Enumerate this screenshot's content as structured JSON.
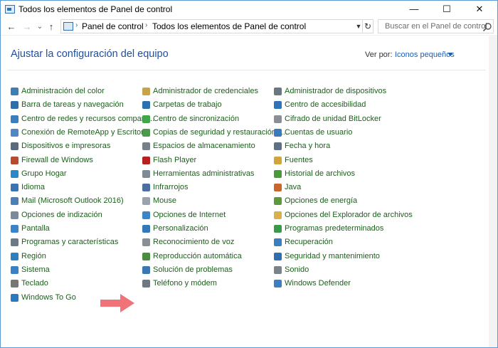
{
  "window": {
    "title": "Todos los elementos de Panel de control"
  },
  "controls": {
    "minimize": "—",
    "maximize": "☐",
    "close": "✕"
  },
  "nav": {
    "back": "←",
    "forward": "→",
    "recent": "⌄",
    "up": "↑"
  },
  "address": {
    "part1": "Panel de control",
    "part2": "Todos los elementos de Panel de control",
    "sep": "›"
  },
  "search": {
    "placeholder": "Buscar en el Panel de control"
  },
  "main": {
    "title": "Ajustar la configuración del equipo",
    "view_by_label": "Ver por:",
    "view_by_value": "Iconos pequeños"
  },
  "columns": [
    [
      {
        "label": "Administración del color",
        "icon": "color-management-icon",
        "color": "#3d7fb5"
      },
      {
        "label": "Barra de tareas y navegación",
        "icon": "taskbar-icon",
        "color": "#2f6ea8"
      },
      {
        "label": "Centro de redes y recursos comparti...",
        "icon": "network-icon",
        "color": "#3a7ebf"
      },
      {
        "label": "Conexión de RemoteApp y Escritorio",
        "icon": "remoteapp-icon",
        "color": "#4f86c6"
      },
      {
        "label": "Dispositivos e impresoras",
        "icon": "printer-icon",
        "color": "#5a6a7a"
      },
      {
        "label": "Firewall de Windows",
        "icon": "firewall-icon",
        "color": "#b84a2e"
      },
      {
        "label": "Grupo Hogar",
        "icon": "homegroup-icon",
        "color": "#2a88c8"
      },
      {
        "label": "Idioma",
        "icon": "language-icon",
        "color": "#3b73b0"
      },
      {
        "label": "Mail (Microsoft Outlook 2016)",
        "icon": "mail-icon",
        "color": "#4a7fb8"
      },
      {
        "label": "Opciones de indización",
        "icon": "indexing-icon",
        "color": "#7a8a99"
      },
      {
        "label": "Pantalla",
        "icon": "display-icon",
        "color": "#3a85c9"
      },
      {
        "label": "Programas y características",
        "icon": "programs-icon",
        "color": "#6c7a88"
      },
      {
        "label": "Región",
        "icon": "region-icon",
        "color": "#2f7fc0"
      },
      {
        "label": "Sistema",
        "icon": "system-icon",
        "color": "#3a80c4"
      },
      {
        "label": "Teclado",
        "icon": "keyboard-icon",
        "color": "#777777"
      },
      {
        "label": "Windows To Go",
        "icon": "windows-to-go-icon",
        "color": "#2b7ac0"
      }
    ],
    [
      {
        "label": "Administrador de credenciales",
        "icon": "credential-icon",
        "color": "#c8a24a"
      },
      {
        "label": "Carpetas de trabajo",
        "icon": "work-folders-icon",
        "color": "#2e6fb0"
      },
      {
        "label": "Centro de sincronización",
        "icon": "sync-icon",
        "color": "#3fa64a"
      },
      {
        "label": "Copias de seguridad y restauración (...",
        "icon": "backup-icon",
        "color": "#4d9a4d"
      },
      {
        "label": "Espacios de almacenamiento",
        "icon": "storage-icon",
        "color": "#777f88"
      },
      {
        "label": "Flash Player",
        "icon": "flash-icon",
        "color": "#b81f1f"
      },
      {
        "label": "Herramientas administrativas",
        "icon": "admin-tools-icon",
        "color": "#7d8b96"
      },
      {
        "label": "Infrarrojos",
        "icon": "infrared-icon",
        "color": "#4a6fa0"
      },
      {
        "label": "Mouse",
        "icon": "mouse-icon",
        "color": "#9aa3ab"
      },
      {
        "label": "Opciones de Internet",
        "icon": "internet-options-icon",
        "color": "#3d86c6"
      },
      {
        "label": "Personalización",
        "icon": "personalization-icon",
        "color": "#3578b8"
      },
      {
        "label": "Reconocimiento de voz",
        "icon": "speech-icon",
        "color": "#8a8f96"
      },
      {
        "label": "Reproducción automática",
        "icon": "autoplay-icon",
        "color": "#4b8d3e"
      },
      {
        "label": "Solución de problemas",
        "icon": "troubleshooting-icon",
        "color": "#3b77b3"
      },
      {
        "label": "Teléfono y módem",
        "icon": "phone-modem-icon",
        "color": "#6f7780"
      }
    ],
    [
      {
        "label": "Administrador de dispositivos",
        "icon": "device-manager-icon",
        "color": "#6a7783"
      },
      {
        "label": "Centro de accesibilidad",
        "icon": "accessibility-icon",
        "color": "#2f74b9"
      },
      {
        "label": "Cifrado de unidad BitLocker",
        "icon": "bitlocker-icon",
        "color": "#8a8f96"
      },
      {
        "label": "Cuentas de usuario",
        "icon": "user-accounts-icon",
        "color": "#3a7abf"
      },
      {
        "label": "Fecha y hora",
        "icon": "date-time-icon",
        "color": "#5d7184"
      },
      {
        "label": "Fuentes",
        "icon": "fonts-icon",
        "color": "#d1a53c"
      },
      {
        "label": "Historial de archivos",
        "icon": "file-history-icon",
        "color": "#4a9a3a"
      },
      {
        "label": "Java",
        "icon": "java-icon",
        "color": "#c8652a"
      },
      {
        "label": "Opciones de energía",
        "icon": "power-icon",
        "color": "#5a9a3a"
      },
      {
        "label": "Opciones del Explorador de archivos",
        "icon": "folder-options-icon",
        "color": "#d8b248"
      },
      {
        "label": "Programas predeterminados",
        "icon": "default-programs-icon",
        "color": "#3a9a4a"
      },
      {
        "label": "Recuperación",
        "icon": "recovery-icon",
        "color": "#3a7fbf"
      },
      {
        "label": "Seguridad y mantenimiento",
        "icon": "security-maintenance-icon",
        "color": "#2f6fae"
      },
      {
        "label": "Sonido",
        "icon": "sound-icon",
        "color": "#7a828a"
      },
      {
        "label": "Windows Defender",
        "icon": "windows-defender-icon",
        "color": "#3b7fc0"
      }
    ]
  ],
  "annotation": {
    "arrow_color": "#f0737a"
  }
}
